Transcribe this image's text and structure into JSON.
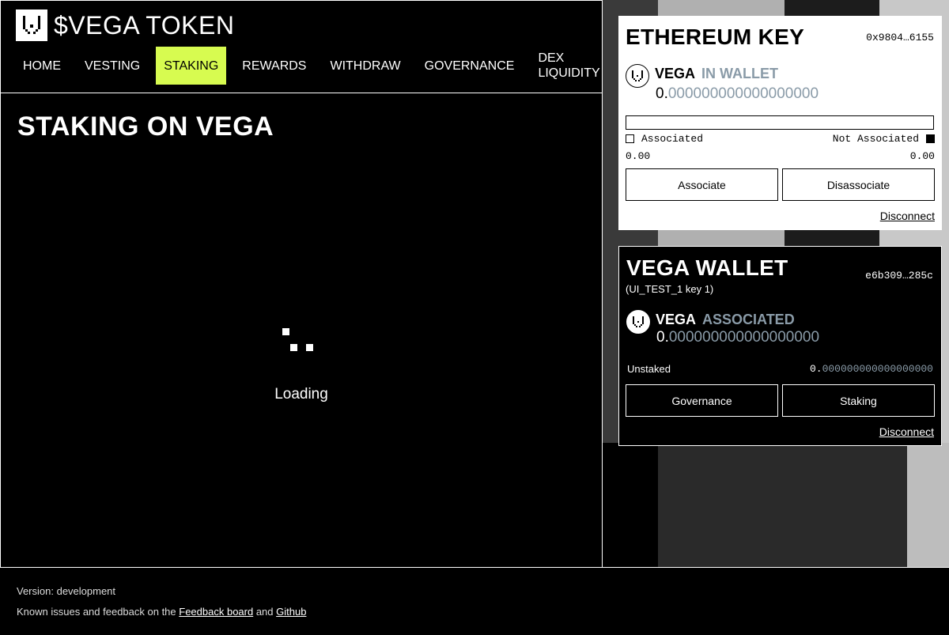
{
  "app": {
    "title": "$VEGA TOKEN"
  },
  "nav": {
    "items": [
      {
        "label": "HOME"
      },
      {
        "label": "VESTING"
      },
      {
        "label": "STAKING"
      },
      {
        "label": "REWARDS"
      },
      {
        "label": "WITHDRAW"
      },
      {
        "label": "GOVERNANCE"
      },
      {
        "label": "DEX\nLIQUIDITY"
      }
    ],
    "active": "STAKING"
  },
  "main": {
    "title": "STAKING ON VEGA",
    "loading_text": "Loading"
  },
  "ethereum_card": {
    "title": "ETHEREUM KEY",
    "address": "0x9804…6155",
    "token_name": "VEGA",
    "token_status": "IN WALLET",
    "amount_int": "0.",
    "amount_dec": "000000000000000000",
    "legend_associated": "Associated",
    "legend_not_associated": "Not Associated",
    "associated_value": "0.00",
    "not_associated_value": "0.00",
    "associate_button": "Associate",
    "disassociate_button": "Disassociate",
    "disconnect_link": "Disconnect"
  },
  "vega_card": {
    "title": "VEGA WALLET",
    "key_id": "e6b309…285c",
    "subtitle": "(UI_TEST_1 key 1)",
    "token_name": "VEGA",
    "token_status": "ASSOCIATED",
    "amount_int": "0.",
    "amount_dec": "000000000000000000",
    "unstaked_label": "Unstaked",
    "unstaked_int": "0.",
    "unstaked_dec": "000000000000000000",
    "governance_button": "Governance",
    "staking_button": "Staking",
    "disconnect_link": "Disconnect"
  },
  "footer": {
    "version_text": "Version: development",
    "feedback_prefix": "Known issues and feedback on the ",
    "feedback_link": "Feedback board",
    "and_text": " and ",
    "github_link": "Github"
  },
  "colors": {
    "accent": "#d7fb50",
    "muted": "#8a9ba8",
    "background": "#000000"
  }
}
